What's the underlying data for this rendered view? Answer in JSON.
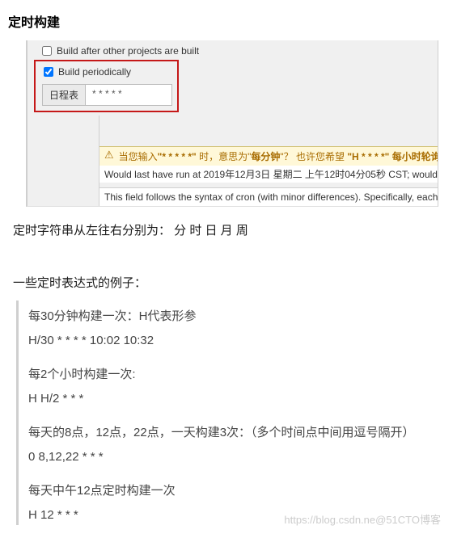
{
  "heading": "定时构建",
  "options": {
    "build_after": "Build after other projects are built",
    "build_periodic": "Build periodically"
  },
  "schedule": {
    "label": "日程表",
    "value": "* * * * *"
  },
  "warning": {
    "icon": "⚠",
    "text_pre": "当您输入",
    "q1": "\"* * * * *\"",
    "mid1": " 时，意思为\"",
    "kw1": "每分钟",
    "mid2": "\"？  也许您希望 ",
    "q2": "\"H * * * *\"",
    "kw2": "每小时轮询"
  },
  "info_line": "Would last have run at 2019年12月3日 星期二 上午12时04分05秒 CST; would ne",
  "help_text": "This field follows the syntax of cron (with minor differences). Specifically, each line cons",
  "cron_order": "定时字符串从左往右分别为：  分 时 日 月 周",
  "examples_title": "一些定时表达式的例子：",
  "examples": {
    "e1_l1": "每30分钟构建一次：H代表形参",
    "e1_l2": "H/30 * * * *       10:02    10:32",
    "e2_l1": "每2个小时构建一次:",
    "e2_l2": "H H/2 * * *",
    "e3_l1": "每天的8点，12点，22点，一天构建3次：（多个时间点中间用逗号隔开）",
    "e3_l2": "0 8,12,22 * * *",
    "e4_l1": "每天中午12点定时构建一次",
    "e4_l2": "H 12 * * *"
  },
  "watermark": "https://blog.csdn.ne@51CTO博客"
}
